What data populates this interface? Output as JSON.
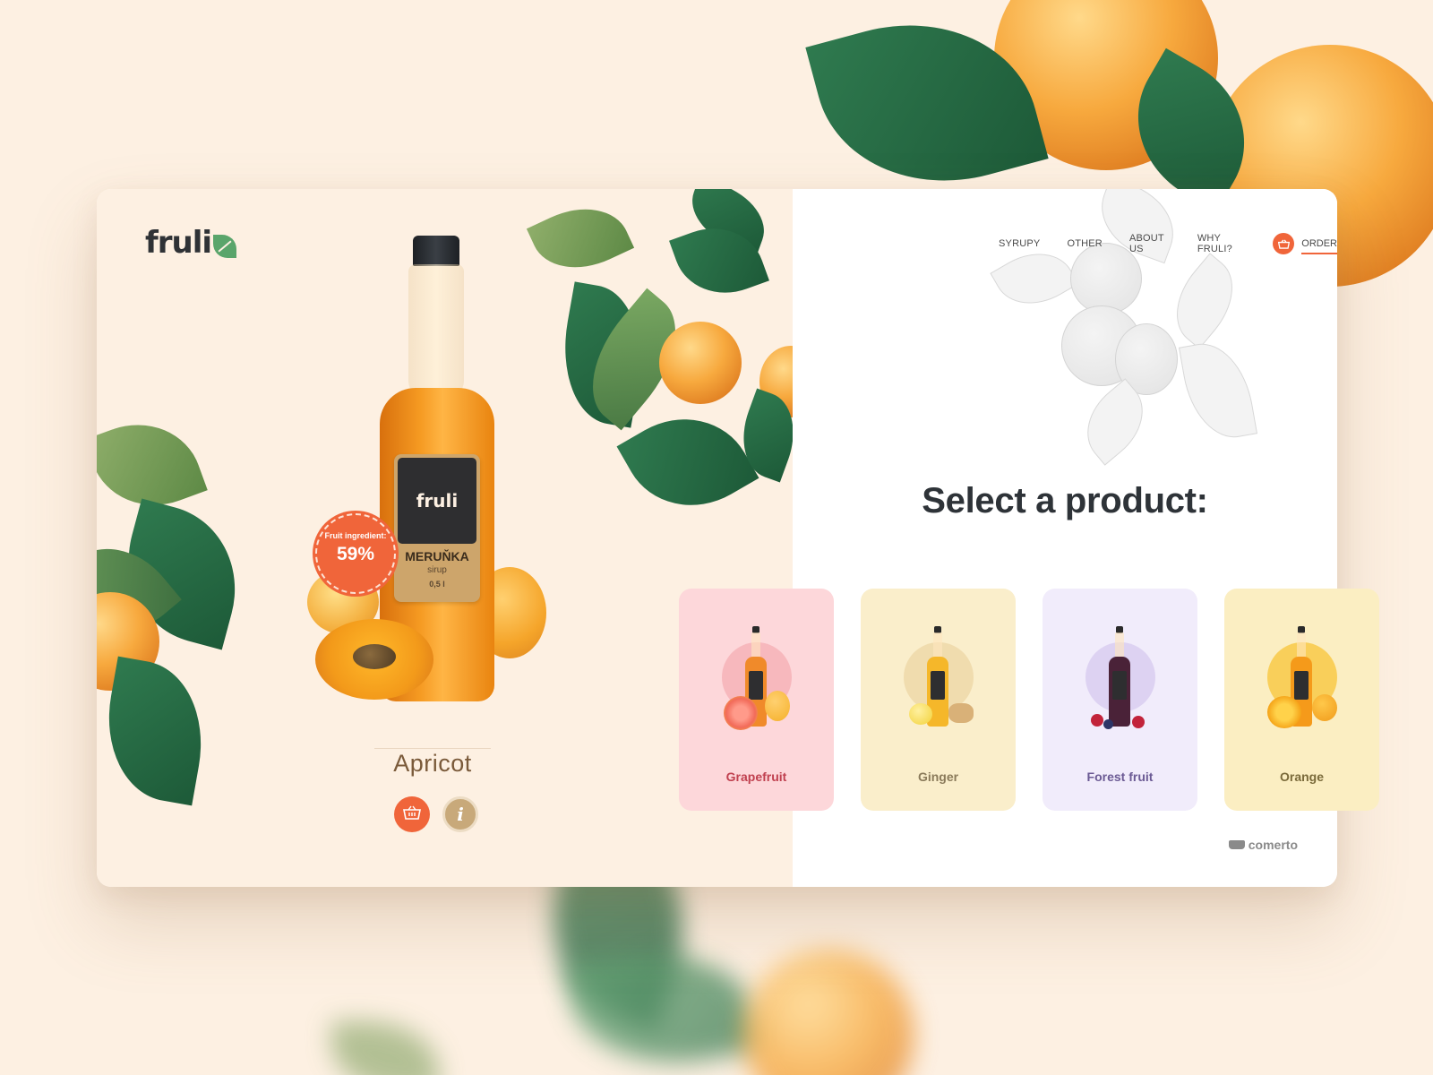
{
  "brand": {
    "logo": "fruli"
  },
  "nav": {
    "items": [
      "SYRUPY",
      "OTHER",
      "ABOUT US",
      "WHY FRULI?"
    ],
    "order": "ORDER"
  },
  "hero": {
    "product_name": "Apricot",
    "bottle_label": {
      "logo": "fruli",
      "name": "MERUŇKA",
      "type": "sirup",
      "volume": "0,5 l"
    },
    "badge": {
      "label": "Fruit ingredient:",
      "value": "59%"
    }
  },
  "main": {
    "title": "Select a product:"
  },
  "products": [
    {
      "name": "Grapefruit",
      "bg": "#fdd7da",
      "circle": "#f7b8bd",
      "text": "#c0404f",
      "liquid": "#f08a2a"
    },
    {
      "name": "Ginger",
      "bg": "#faeecb",
      "circle": "#f0dcae",
      "text": "#8a7a5a",
      "liquid": "#f5b72a"
    },
    {
      "name": "Forest fruit",
      "bg": "#f1ecfb",
      "circle": "#ddd2f2",
      "text": "#6b5a94",
      "liquid": "#4a2238"
    },
    {
      "name": "Orange",
      "bg": "#fbeec2",
      "circle": "#f9cf5a",
      "text": "#7a6a3a",
      "liquid": "#f59a1a"
    }
  ],
  "footer": {
    "powered_by": "comerto"
  },
  "colors": {
    "accent": "#f0653a",
    "background": "#fdf0e2"
  }
}
